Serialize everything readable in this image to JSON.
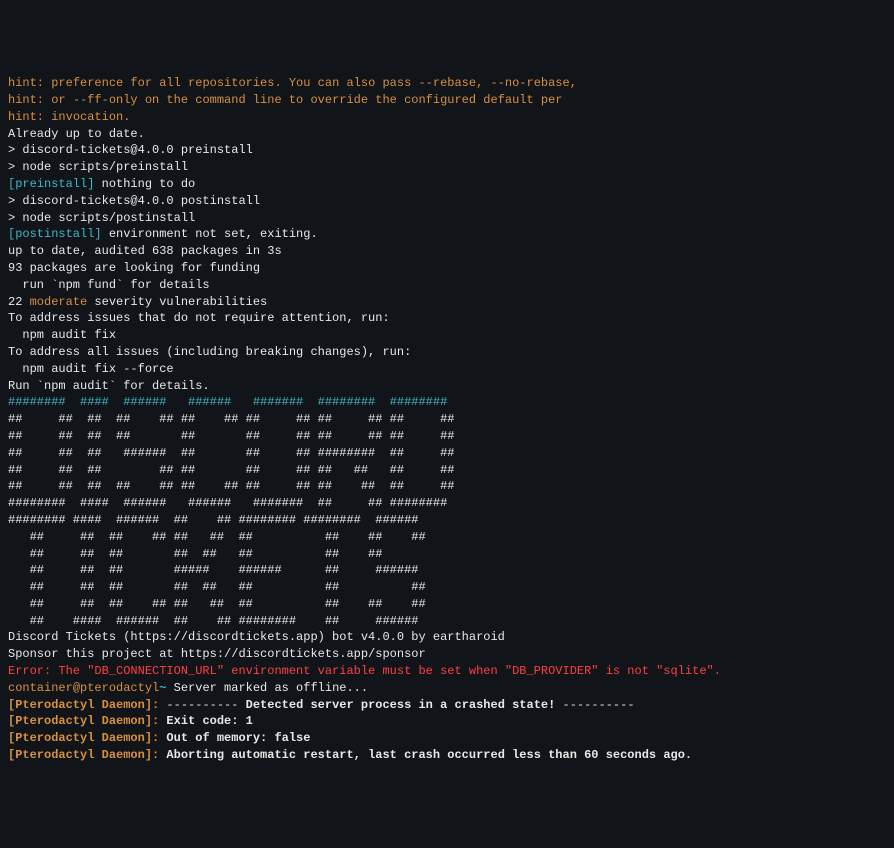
{
  "hints": [
    {
      "prefix": "hint:",
      "text": " preference for all repositories. You can also pass --rebase, --no-rebase,"
    },
    {
      "prefix": "hint:",
      "text": " or --ff-only on the command line to override the configured default per"
    },
    {
      "prefix": "hint:",
      "text": " invocation."
    }
  ],
  "lines": {
    "already_up_to_date": "Already up to date.",
    "blank": "",
    "preinstall_cmd": "> discord-tickets@4.0.0 preinstall",
    "preinstall_node": "> node scripts/preinstall",
    "preinstall_tag": "[preinstall]",
    "preinstall_msg": " nothing to do",
    "postinstall_cmd": "> discord-tickets@4.0.0 postinstall",
    "postinstall_node": "> node scripts/postinstall",
    "postinstall_tag": "[postinstall]",
    "postinstall_msg": " environment not set, exiting.",
    "audit1": "up to date, audited 638 packages in 3s",
    "audit2": "93 packages are looking for funding",
    "audit3": "  run `npm fund` for details",
    "vuln_count": "22 ",
    "vuln_severity": "moderate",
    "vuln_rest": " severity vulnerabilities",
    "address1": "To address issues that do not require attention, run:",
    "address2": "  npm audit fix",
    "address3": "To address all issues (including breaking changes), run:",
    "address4": "  npm audit fix --force",
    "address5": "Run `npm audit` for details.",
    "discord_line": "Discord Tickets (https://discordtickets.app) bot v4.0.0 by eartharoid",
    "sponsor_line": "Sponsor this project at https://discordtickets.app/sponsor",
    "error_line": "Error: The \"DB_CONNECTION_URL\" environment variable must be set when \"DB_PROVIDER\" is not \"sqlite\".",
    "prompt_user": "container",
    "prompt_at": "@",
    "prompt_host": "pterodactyl",
    "prompt_tilde": "~",
    "server_offline": " Server marked as offline...",
    "daemon_prefix": "[Pterodactyl Daemon]:",
    "daemon1": " ---------- Detected server process in a crashed state! ----------",
    "daemon1_pre": " ---------- ",
    "daemon1_mid": "Detected server process in a crashed state!",
    "daemon1_post": " ----------",
    "daemon2": " Exit code: 1",
    "daemon3": " Out of memory: false",
    "daemon4": " Aborting automatic restart, last crash occurred less than 60 seconds ago."
  },
  "ascii": [
    "########  ####  ######   ######   #######  ########  ######## ",
    "##     ##  ##  ##    ## ##    ## ##     ## ##     ## ##     ##",
    "##     ##  ##  ##       ##       ##     ## ##     ## ##     ##",
    "##     ##  ##   ######  ##       ##     ## ########  ##     ##",
    "##     ##  ##        ## ##       ##     ## ##   ##   ##     ##",
    "##     ##  ##  ##    ## ##    ## ##     ## ##    ##  ##     ##",
    "########  ####  ######   ######   #######  ##     ## ######## ",
    "######## ####  ######  ##    ## ######## ########  ######  ",
    "   ##     ##  ##    ## ##   ##  ##          ##    ##    ## ",
    "   ##     ##  ##       ##  ##   ##          ##    ##       ",
    "   ##     ##  ##       #####    ######      ##     ######  ",
    "   ##     ##  ##       ##  ##   ##          ##          ## ",
    "   ##     ##  ##    ## ##   ##  ##          ##    ##    ## ",
    "   ##    ####  ######  ##    ## ########    ##     ######  "
  ]
}
